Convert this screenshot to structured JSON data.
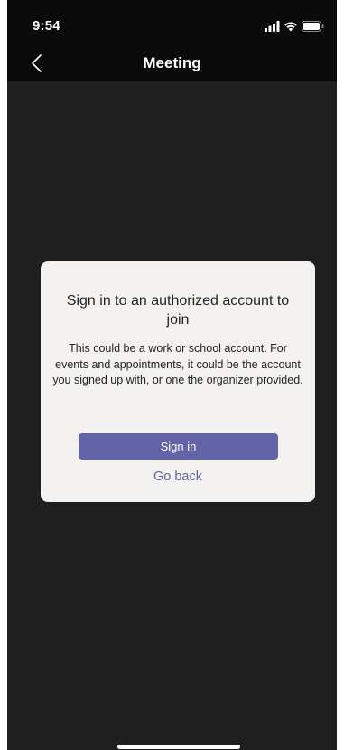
{
  "status_bar": {
    "time": "9:54",
    "icons": [
      "cellular-signal-icon",
      "wifi-icon",
      "battery-icon"
    ]
  },
  "header": {
    "back_icon": "chevron-left-icon",
    "title": "Meeting"
  },
  "dialog": {
    "title": "Sign in to an authorized account to join",
    "body": "This could be a work or school account. For events and appointments, it could be the account you signed up with, or one the organizer provided.",
    "primary_button": "Sign in",
    "secondary_link": "Go back"
  },
  "colors": {
    "accent": "#6264a7",
    "background": "#1f1f1f",
    "header_background": "#0a0a0a",
    "dialog_background": "#f3f2f1"
  }
}
